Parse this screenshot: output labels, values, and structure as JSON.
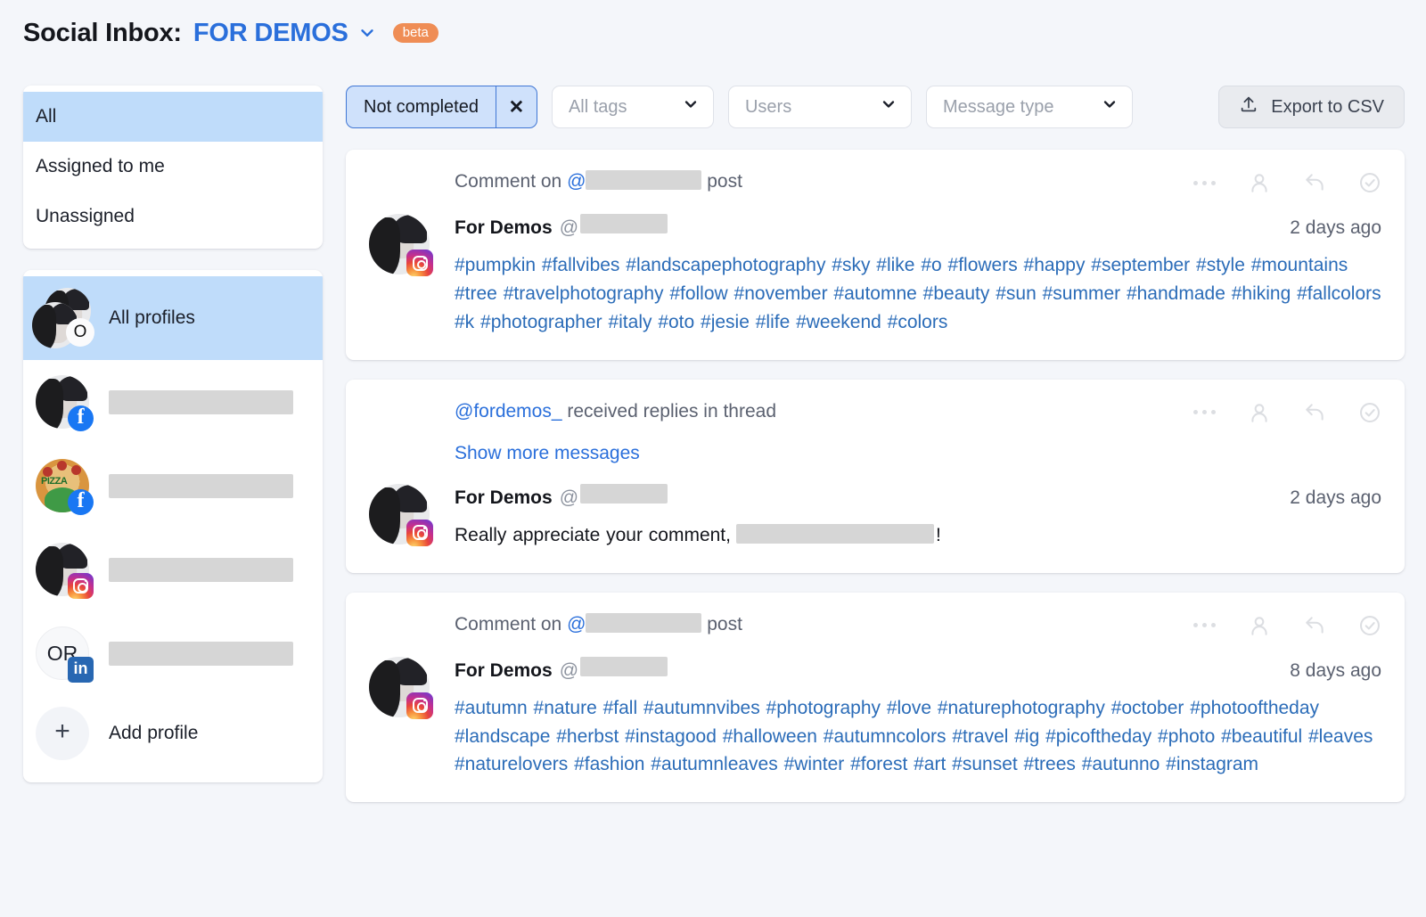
{
  "header": {
    "title": "Social Inbox:",
    "account": "FOR DEMOS",
    "caret_icon": "chevron-down-icon",
    "beta_label": "beta"
  },
  "sidebar": {
    "scopes": [
      {
        "label": "All",
        "active": true
      },
      {
        "label": "Assigned to me",
        "active": false
      },
      {
        "label": "Unassigned",
        "active": false
      }
    ],
    "profiles": [
      {
        "label": "All profiles",
        "active": true,
        "avatar": "avatar-stack",
        "initials": "O",
        "network": ""
      },
      {
        "label": "",
        "redacted": true,
        "active": false,
        "avatar": "portrait",
        "network": "facebook"
      },
      {
        "label": "",
        "redacted": true,
        "active": false,
        "avatar": "pizza",
        "network": "facebook"
      },
      {
        "label": "",
        "redacted": true,
        "active": false,
        "avatar": "portrait",
        "network": "instagram"
      },
      {
        "label": "",
        "redacted": true,
        "active": false,
        "avatar": "initials",
        "initials": "OR",
        "network": "linkedin"
      }
    ],
    "add_profile_label": "Add profile",
    "add_profile_icon": "plus-icon"
  },
  "filters": {
    "status_chip": {
      "label": "Not completed",
      "clear_icon": "close-icon"
    },
    "tags": {
      "placeholder": "All tags",
      "caret_icon": "chevron-down-icon"
    },
    "users": {
      "placeholder": "Users",
      "caret_icon": "chevron-down-icon"
    },
    "message_type": {
      "placeholder": "Message type",
      "caret_icon": "chevron-down-icon"
    },
    "export": {
      "label": "Export to CSV",
      "icon": "upload-icon"
    }
  },
  "actions": {
    "more_icon": "ellipsis-icon",
    "assign_icon": "person-icon",
    "reply_icon": "reply-arrow-icon",
    "complete_icon": "check-circle-icon"
  },
  "messages": [
    {
      "context_prefix": "Comment on ",
      "context_at": "@",
      "context_redacted": true,
      "context_suffix": " post",
      "context_link_text": "",
      "show_more": "",
      "author": "For Demos",
      "handle_at": "@",
      "handle_redacted": true,
      "time": "2 days ago",
      "network": "instagram",
      "text_style": "hashtags",
      "text": "#pumpkin #fallvibes #landscapephotography #sky #like #o #flowers #happy #september #style #mountains #tree #travelphotography #follow #november #automne #beauty #sun #summer #handmade #hiking #fallcolors #k #photographer #italy #oto #jesie #life #weekend #colors"
    },
    {
      "context_prefix": "",
      "context_at": "",
      "context_redacted": false,
      "context_suffix": " received replies in thread",
      "context_link_text": "@fordemos_",
      "show_more": "Show more messages",
      "author": "For Demos",
      "handle_at": "@",
      "handle_redacted": true,
      "time": "2 days ago",
      "network": "instagram",
      "text_style": "plain",
      "text_before": "Really appreciate your comment,",
      "text_after": "!",
      "text": ""
    },
    {
      "context_prefix": "Comment on ",
      "context_at": "@",
      "context_redacted": true,
      "context_suffix": " post",
      "context_link_text": "",
      "show_more": "",
      "author": "For Demos",
      "handle_at": "@",
      "handle_redacted": true,
      "time": "8 days ago",
      "network": "instagram",
      "text_style": "hashtags",
      "text": "#autumn #nature #fall #autumnvibes #photography #love #naturephotography #october #photooftheday #landscape #herbst #instagood #halloween #autumncolors #travel #ig #picoftheday #photo #beautiful #leaves #naturelovers #fashion #autumnleaves #winter #forest #art #sunset #trees #autunno #instagram"
    }
  ],
  "colors": {
    "accent_blue": "#2a6fdb",
    "link_blue": "#2b6cb8",
    "selected_bg": "#bfdcfa",
    "beta_orange": "#ef8d55",
    "page_bg": "#f4f6fa"
  }
}
